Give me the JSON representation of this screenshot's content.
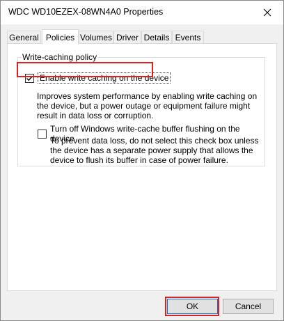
{
  "window": {
    "title": "WDC WD10EZEX-08WN4A0 Properties",
    "close_icon": "close-icon"
  },
  "tabs": [
    {
      "label": "General"
    },
    {
      "label": "Policies",
      "active": true
    },
    {
      "label": "Volumes"
    },
    {
      "label": "Driver"
    },
    {
      "label": "Details"
    },
    {
      "label": "Events"
    }
  ],
  "policies": {
    "group_label": "Write-caching policy",
    "enable_caching": {
      "label": "Enable write caching on the device",
      "checked": true,
      "description": "Improves system performance by enabling write caching on the device, but a power outage or equipment failure might result in data loss or corruption."
    },
    "turn_off_flushing": {
      "label": "Turn off Windows write-cache buffer flushing on the device",
      "checked": false,
      "description": "To prevent data loss, do not select this check box unless the device has a separate power supply that allows the device to flush its buffer in case of power failure."
    }
  },
  "buttons": {
    "ok": "OK",
    "cancel": "Cancel"
  },
  "colors": {
    "highlight": "#e02020",
    "focus_border": "#0078d7"
  }
}
